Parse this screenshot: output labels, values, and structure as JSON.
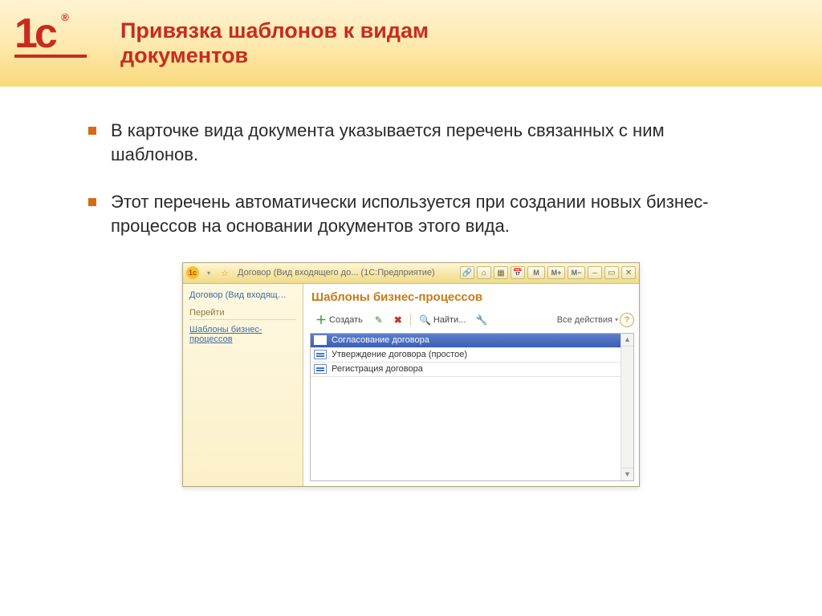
{
  "slide": {
    "logo_text": "1c",
    "title": "Привязка шаблонов к видам документов",
    "bullets": [
      "В карточке вида документа указывается перечень связанных с ним шаблонов.",
      "Этот перечень автоматически используется при создании новых бизнес-процессов на основании документов этого вида."
    ]
  },
  "window": {
    "titlebar": {
      "title": "Договор (Вид входящего до...  (1С:Предприятие)",
      "m_buttons": [
        "M",
        "M+",
        "M−"
      ]
    },
    "sidebar": {
      "heading": "Договор (Вид входящ…",
      "section_label": "Перейти",
      "items": [
        {
          "label": "Шаблоны бизнес-процессов"
        }
      ]
    },
    "main": {
      "title": "Шаблоны бизнес-процессов",
      "toolbar": {
        "create": "Создать",
        "find": "Найти...",
        "all_actions": "Все действия"
      },
      "rows": [
        {
          "label": "Согласование договора",
          "selected": true
        },
        {
          "label": "Утверждение договора (простое)",
          "selected": false
        },
        {
          "label": "Регистрация договора",
          "selected": false
        }
      ]
    }
  }
}
